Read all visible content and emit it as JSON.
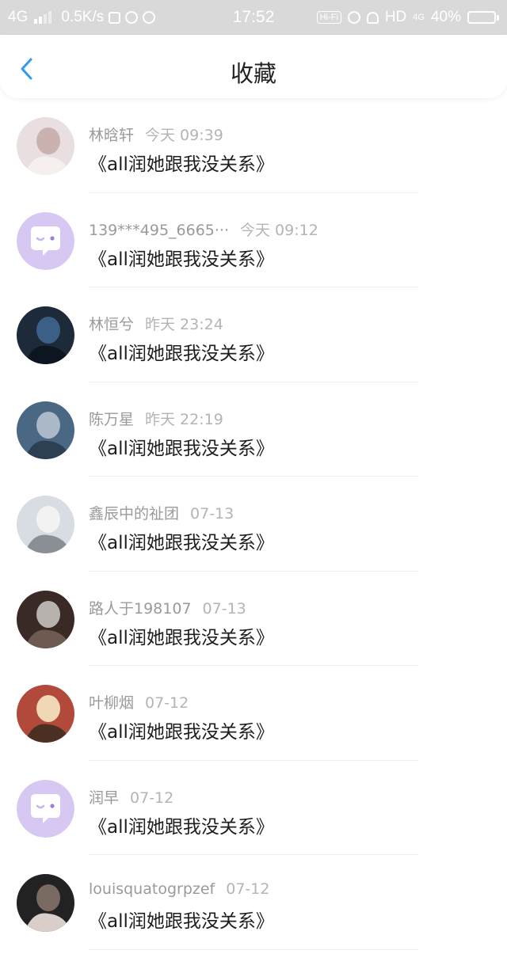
{
  "status_bar": {
    "network": "4G",
    "speed": "0.5K/s",
    "time": "17:52",
    "hifi_label": "Hi-Fi",
    "hd_label": "HD",
    "net_small": "4G",
    "battery_text": "40%",
    "battery_level": 0.4
  },
  "header": {
    "back_icon": "chevron-left-icon",
    "title": "收藏",
    "accent_color": "#2f9bf3"
  },
  "favorites": [
    {
      "user": "林晗轩",
      "time": "今天 09:39",
      "book": "《all润她跟我没关系》",
      "avatar": "photo"
    },
    {
      "user": "139***495_6665···",
      "time": "今天 09:12",
      "book": "《all润她跟我没关系》",
      "avatar": "default"
    },
    {
      "user": "林恒兮",
      "time": "昨天 23:24",
      "book": "《all润她跟我没关系》",
      "avatar": "photo"
    },
    {
      "user": "陈万星",
      "time": "昨天 22:19",
      "book": "《all润她跟我没关系》",
      "avatar": "photo"
    },
    {
      "user": "鑫辰中的祉团",
      "time": "07-13",
      "book": "《all润她跟我没关系》",
      "avatar": "photo"
    },
    {
      "user": "路人于198107",
      "time": "07-13",
      "book": "《all润她跟我没关系》",
      "avatar": "photo"
    },
    {
      "user": "叶柳烟",
      "time": "07-12",
      "book": "《all润她跟我没关系》",
      "avatar": "photo"
    },
    {
      "user": "润早",
      "time": "07-12",
      "book": "《all润她跟我没关系》",
      "avatar": "default"
    },
    {
      "user": "louisquatogrpzef",
      "time": "07-12",
      "book": "《all润她跟我没关系》",
      "avatar": "photo"
    }
  ]
}
